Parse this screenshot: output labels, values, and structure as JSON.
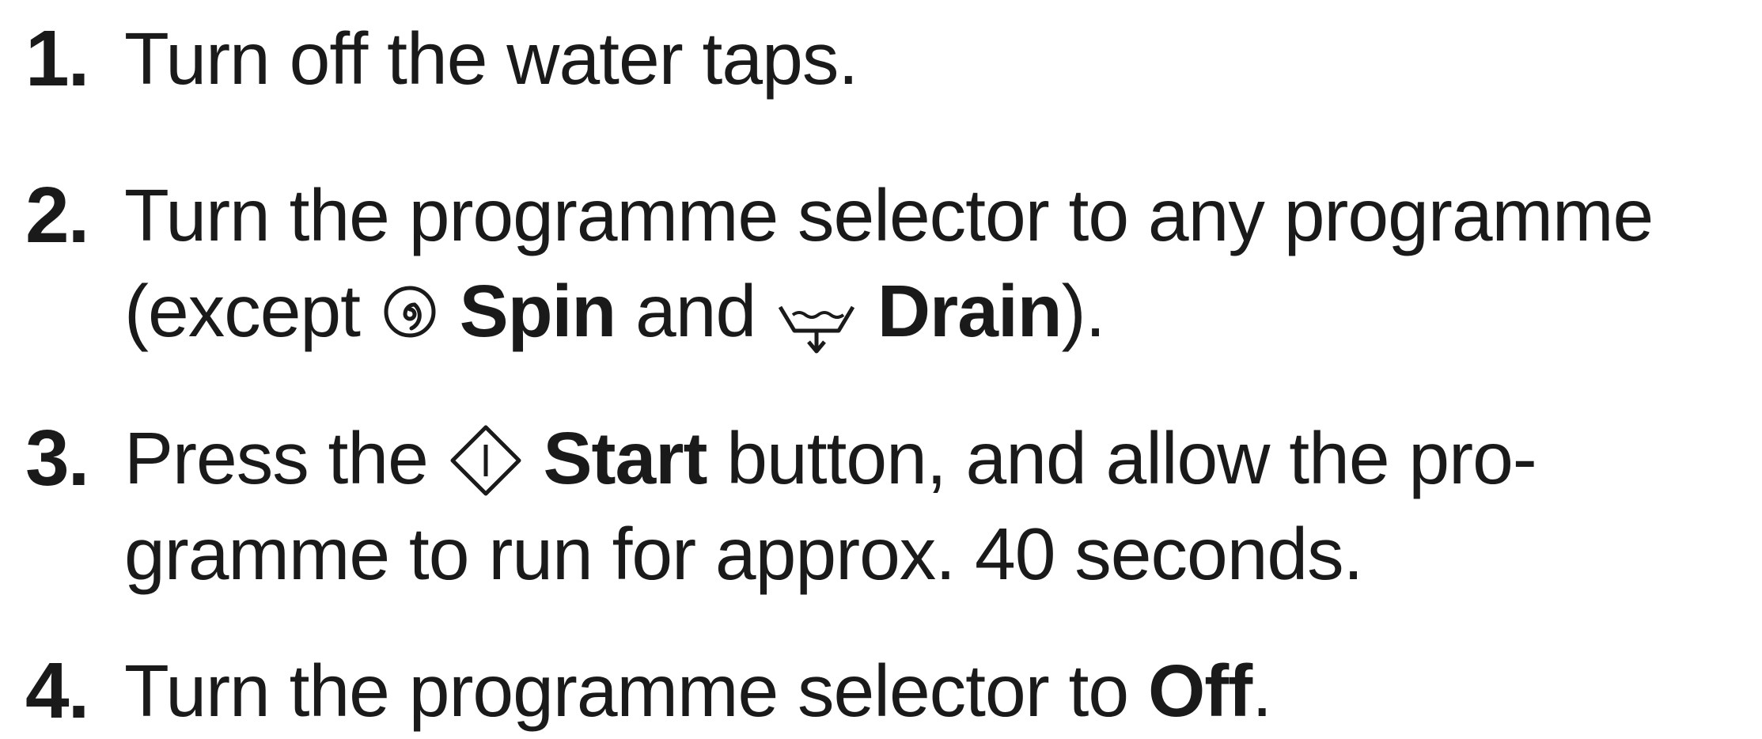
{
  "steps": [
    {
      "number": "1.",
      "text": "Turn off the water taps."
    },
    {
      "number": "2.",
      "line1": "Turn the programme selector to any programme",
      "line2_pre": "(except",
      "spin_icon": "spin-spiral-icon",
      "spin_label": "Spin",
      "and": "and",
      "drain_icon": "drain-tub-icon",
      "drain_label": "Drain",
      "line2_post": ")."
    },
    {
      "number": "3.",
      "pre": "Press the",
      "start_icon": "start-diamond-icon",
      "start_label": "Start",
      "post": " button, and allow the pro-",
      "line2": "gramme to run for approx. 40 seconds."
    },
    {
      "number": "4.",
      "pre": "Turn the programme selector to",
      "off_label": "Off",
      "post": "."
    }
  ],
  "colors": {
    "text": "#1a1a1a",
    "background": "#ffffff"
  }
}
